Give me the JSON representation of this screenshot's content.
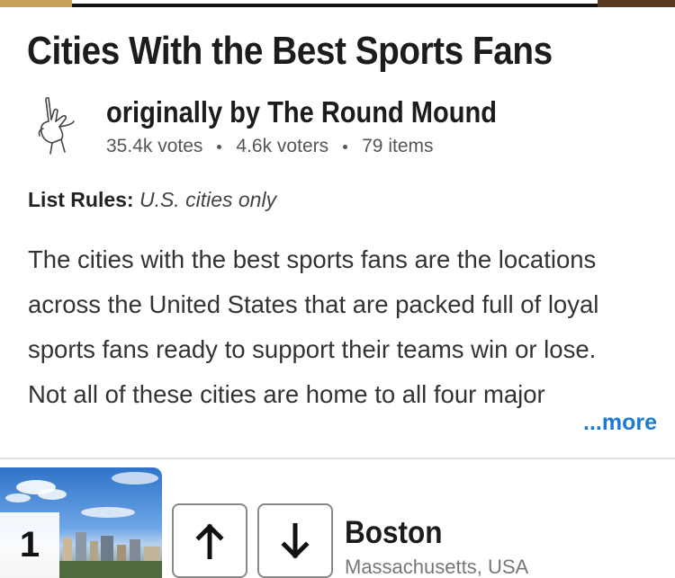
{
  "list": {
    "title": "Cities With the Best Sports Fans",
    "author_line": "originally by The Round Mound",
    "votes": "35.4k votes",
    "voters": "4.6k voters",
    "items": "79 items",
    "rules_label": "List Rules:",
    "rules_value": "U.S. cities only",
    "description_lines": [
      "The cities with the best sports fans are the locations",
      "across the United States that are packed full of loyal",
      "sports fans ready to support their teams win or lose.",
      "Not all of these cities are home to all four major"
    ],
    "more_label": "...more"
  },
  "entries": [
    {
      "rank": "1",
      "name": "Boston",
      "subtitle": "Massachusetts, USA"
    }
  ],
  "colors": {
    "link": "#1a7ad4",
    "title": "#1c1c1c",
    "meta": "#555555"
  },
  "icons": {
    "author": "hand-sign-icon",
    "upvote": "arrow-up-icon",
    "downvote": "arrow-down-icon"
  }
}
